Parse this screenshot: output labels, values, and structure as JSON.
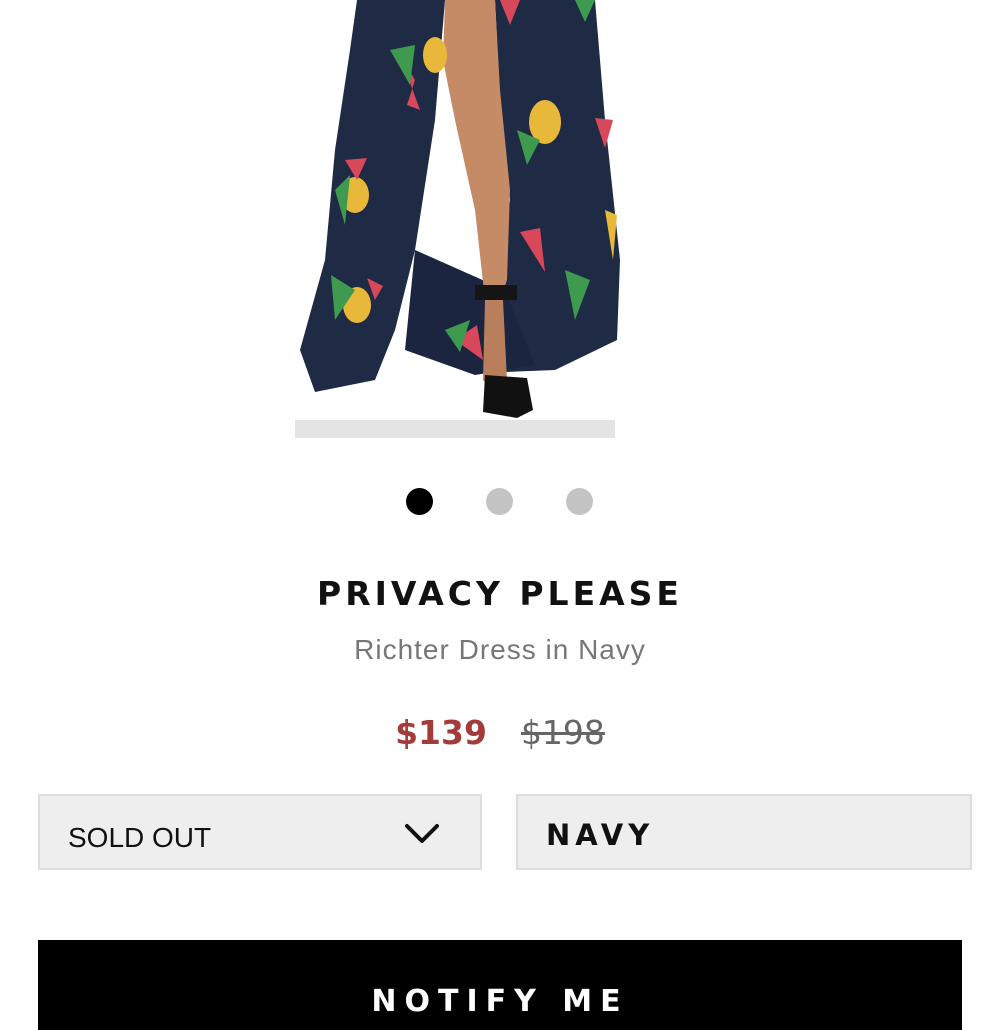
{
  "product": {
    "brand": "PRIVACY PLEASE",
    "name": "Richter Dress in Navy",
    "sale_price": "$139",
    "original_price": "$198",
    "image_icon": "product-photo",
    "gallery": {
      "count": 3,
      "active_index": 0
    }
  },
  "size_select": {
    "value": "SOLD OUT",
    "icon": "chevron-down-icon"
  },
  "color_select": {
    "value": "NAVY"
  },
  "cta": {
    "label": "NOTIFY ME"
  },
  "colors": {
    "sale": "#a33b3b",
    "dress": "#1f2a44",
    "button_bg": "#000000",
    "field_bg": "#eeeeee"
  }
}
